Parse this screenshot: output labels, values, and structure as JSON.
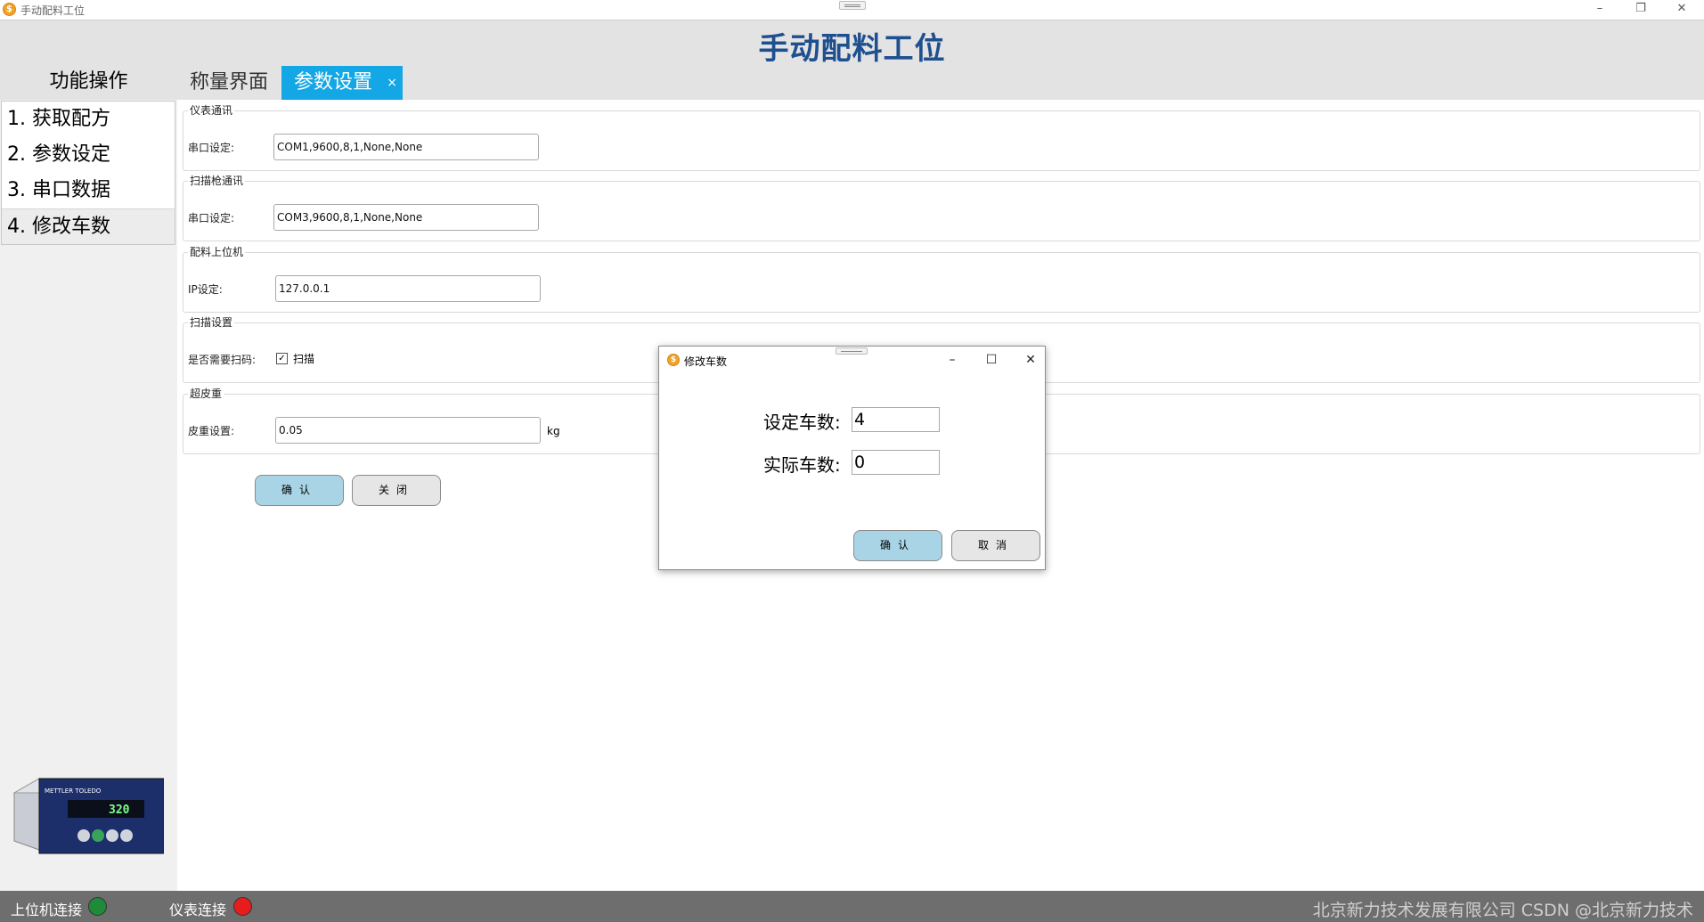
{
  "window": {
    "title": "手动配料工位",
    "app_icon_char": "$",
    "controls": {
      "minimize": "–",
      "restore": "❐",
      "close": "✕"
    }
  },
  "header": {
    "title": "手动配料工位"
  },
  "sidebar": {
    "title": "功能操作",
    "items": [
      {
        "label": "1. 获取配方"
      },
      {
        "label": "2. 参数设定"
      },
      {
        "label": "3. 串口数据"
      },
      {
        "label": "4. 修改车数",
        "active": true
      }
    ],
    "device": {
      "brand": "METTLER TOLEDO",
      "display": "320"
    }
  },
  "tabs": [
    {
      "label": "称量界面"
    },
    {
      "label": "参数设置",
      "active": true,
      "close": "×"
    }
  ],
  "settings": {
    "meter_comm": {
      "title": "仪表通讯",
      "label": "串口设定:",
      "value": "COM1,9600,8,1,None,None"
    },
    "scanner_comm": {
      "title": "扫描枪通讯",
      "label": "串口设定:",
      "value": "COM3,9600,8,1,None,None"
    },
    "host": {
      "title": "配料上位机",
      "label": "IP设定:",
      "value": "127.0.0.1"
    },
    "scan": {
      "title": "扫描设置",
      "label": "是否需要扫码:",
      "checkbox_label": "扫描",
      "checked": true,
      "check_mark": "✓"
    },
    "tare": {
      "title": "超皮重",
      "label": "皮重设置:",
      "value": "0.05",
      "unit": "kg"
    },
    "confirm_label": "确认",
    "close_label": "关闭"
  },
  "dialog": {
    "title": "修改车数",
    "controls": {
      "minimize": "–",
      "maximize": "☐",
      "close": "✕"
    },
    "set_label": "设定车数:",
    "set_value": "4",
    "actual_label": "实际车数:",
    "actual_value": "0",
    "confirm_label": "确认",
    "cancel_label": "取消"
  },
  "status": {
    "host_label": "上位机连接",
    "host_color": "#1f8a3a",
    "meter_label": "仪表连接",
    "meter_color": "#e81c1c",
    "watermark": "北京新力技术发展有限公司 CSDN @北京新力技术"
  }
}
